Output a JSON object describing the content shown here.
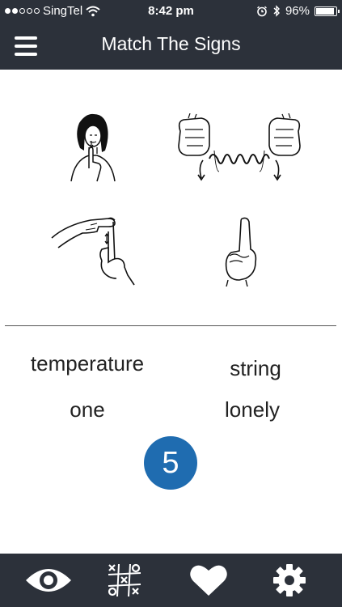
{
  "status_bar": {
    "carrier": "SingTel",
    "time": "8:42 pm",
    "battery": "96%",
    "battery_level": 0.96,
    "signal_bars": 2,
    "signal_total": 5
  },
  "header": {
    "title": "Match The Signs"
  },
  "signs": [
    {
      "icon": "sign-quiet-icon"
    },
    {
      "icon": "sign-string-icon"
    },
    {
      "icon": "sign-temperature-icon"
    },
    {
      "icon": "sign-one-icon"
    }
  ],
  "words": [
    "temperature",
    "string",
    "one",
    "lonely"
  ],
  "count": "5",
  "colors": {
    "bar_background": "#2c313a",
    "badge": "#1f6cb0",
    "text": "#222222",
    "icon": "#ffffff"
  },
  "tabs": [
    {
      "icon": "eye-icon"
    },
    {
      "icon": "tic-tac-toe-icon"
    },
    {
      "icon": "heart-icon"
    },
    {
      "icon": "gear-icon"
    }
  ]
}
